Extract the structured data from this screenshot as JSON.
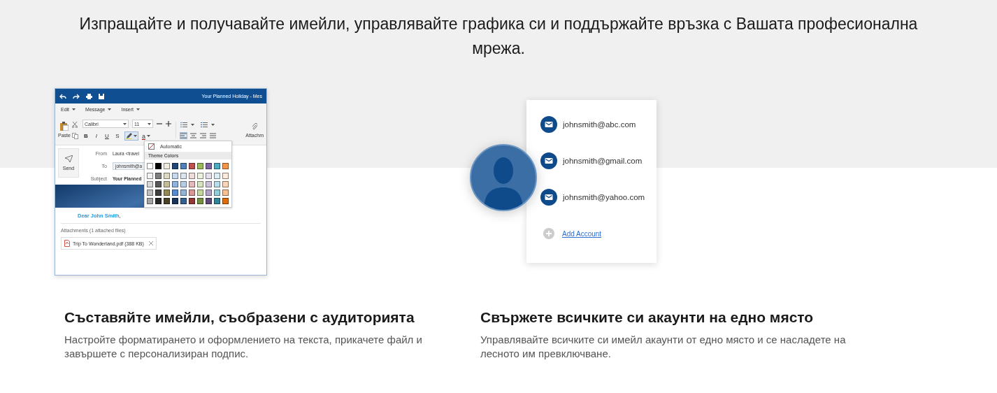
{
  "headline": "Изпращайте и получавайте имейли, управлявайте графика си и поддържайте връзка с Вашата професионална мрежа.",
  "mail_window": {
    "title": "Your Planned Holiday - Mes",
    "menu": [
      {
        "label": "Edit"
      },
      {
        "label": "Message"
      },
      {
        "label": "Insert"
      }
    ],
    "paste": "Paste",
    "font": "Calibri",
    "size": "11",
    "format_buttons": [
      "B",
      "I",
      "U",
      "S"
    ],
    "font_color_glyph": "a",
    "attach": "Attachm",
    "send": "Send",
    "fields": [
      {
        "label": "From",
        "value": "Laura <travel",
        "kind": "plain"
      },
      {
        "label": "To",
        "value": "johnsmith@a",
        "kind": "boxed"
      },
      {
        "label": "Subject",
        "value": "Your Planned",
        "kind": "bold"
      }
    ],
    "greeting": "Dear John Smith,",
    "attachments_label": "Attachments (1 attached files)",
    "attachment": "Trip To Wonderland.pdf (388 KB)",
    "palette": {
      "automatic": "Automatic",
      "header": "Theme Colors",
      "swatch_rows": [
        {
          "swatches": [
            {
              "color": "#ffffff"
            },
            {
              "color": "#000000"
            },
            {
              "color": "#eeece1"
            },
            {
              "color": "#1f497d"
            },
            {
              "color": "#4f81bd"
            },
            {
              "color": "#c0504d"
            },
            {
              "color": "#9bbb59"
            },
            {
              "color": "#8064a2"
            },
            {
              "color": "#4bacc6"
            },
            {
              "color": "#f79646"
            }
          ]
        },
        {
          "swatches": [
            {
              "color": "#f2f2f2"
            },
            {
              "color": "#7f7f7f"
            },
            {
              "color": "#ddd9c3"
            },
            {
              "color": "#c6d9f0"
            },
            {
              "color": "#dbe5f1"
            },
            {
              "color": "#f2dcdb"
            },
            {
              "color": "#ebf1dd"
            },
            {
              "color": "#e5e0ec"
            },
            {
              "color": "#dbeef3"
            },
            {
              "color": "#fdeada"
            }
          ]
        },
        {
          "swatches": [
            {
              "color": "#d8d8d8"
            },
            {
              "color": "#595959"
            },
            {
              "color": "#c4bd97"
            },
            {
              "color": "#8db3e2"
            },
            {
              "color": "#b8cce4"
            },
            {
              "color": "#e5b9b7"
            },
            {
              "color": "#d7e3bc"
            },
            {
              "color": "#ccc1d9"
            },
            {
              "color": "#b7dde8"
            },
            {
              "color": "#fbd5b5"
            }
          ]
        },
        {
          "swatches": [
            {
              "color": "#bfbfbf"
            },
            {
              "color": "#3f3f3f"
            },
            {
              "color": "#938953"
            },
            {
              "color": "#548dd4"
            },
            {
              "color": "#95b3d7"
            },
            {
              "color": "#d99694"
            },
            {
              "color": "#c3d69b"
            },
            {
              "color": "#b2a2c7"
            },
            {
              "color": "#92cddc"
            },
            {
              "color": "#fac08f"
            }
          ]
        },
        {
          "swatches": [
            {
              "color": "#a5a5a5"
            },
            {
              "color": "#262626"
            },
            {
              "color": "#494429"
            },
            {
              "color": "#17365d"
            },
            {
              "color": "#366092"
            },
            {
              "color": "#953734"
            },
            {
              "color": "#76923c"
            },
            {
              "color": "#5f497a"
            },
            {
              "color": "#31859b"
            },
            {
              "color": "#e36c09"
            }
          ]
        }
      ]
    }
  },
  "accounts_card": {
    "accounts": [
      {
        "email": "johnsmith@abc.com"
      },
      {
        "email": "johnsmith@gmail.com"
      },
      {
        "email": "johnsmith@yahoo.com"
      }
    ],
    "add_label": "Add Account"
  },
  "features": [
    {
      "title": "Съставяйте имейли, съобразени с аудиторията",
      "text": "Настройте форматирането и оформлението на текста, прикачете файл и завършете с персонализиран подпис."
    },
    {
      "title": "Свържете всичките си акаунти на едно място",
      "text": "Управлявайте всичките си имейл акаунти от едно място и се насладете на лесното им превключване."
    }
  ]
}
